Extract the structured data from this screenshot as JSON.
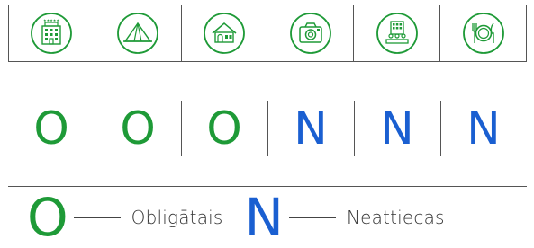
{
  "icons": [
    {
      "name": "hotel-icon",
      "color": "#1e9a37"
    },
    {
      "name": "tent-icon",
      "color": "#1e9a37"
    },
    {
      "name": "guesthouse-icon",
      "color": "#1e9a37"
    },
    {
      "name": "camera-icon",
      "color": "#1e9a37"
    },
    {
      "name": "conference-icon",
      "color": "#1e9a37"
    },
    {
      "name": "dining-icon",
      "color": "#1e9a37"
    }
  ],
  "letters": [
    {
      "text": "O",
      "color": "#1e9a37"
    },
    {
      "text": "O",
      "color": "#1e9a37"
    },
    {
      "text": "O",
      "color": "#1e9a37"
    },
    {
      "text": "N",
      "color": "#1a5fd1"
    },
    {
      "text": "N",
      "color": "#1a5fd1"
    },
    {
      "text": "N",
      "color": "#1a5fd1"
    }
  ],
  "legend": {
    "mandatory_letter": "O",
    "mandatory_label": "Obligātais",
    "not_applicable_letter": "N",
    "not_applicable_label": "Neattiecas"
  }
}
